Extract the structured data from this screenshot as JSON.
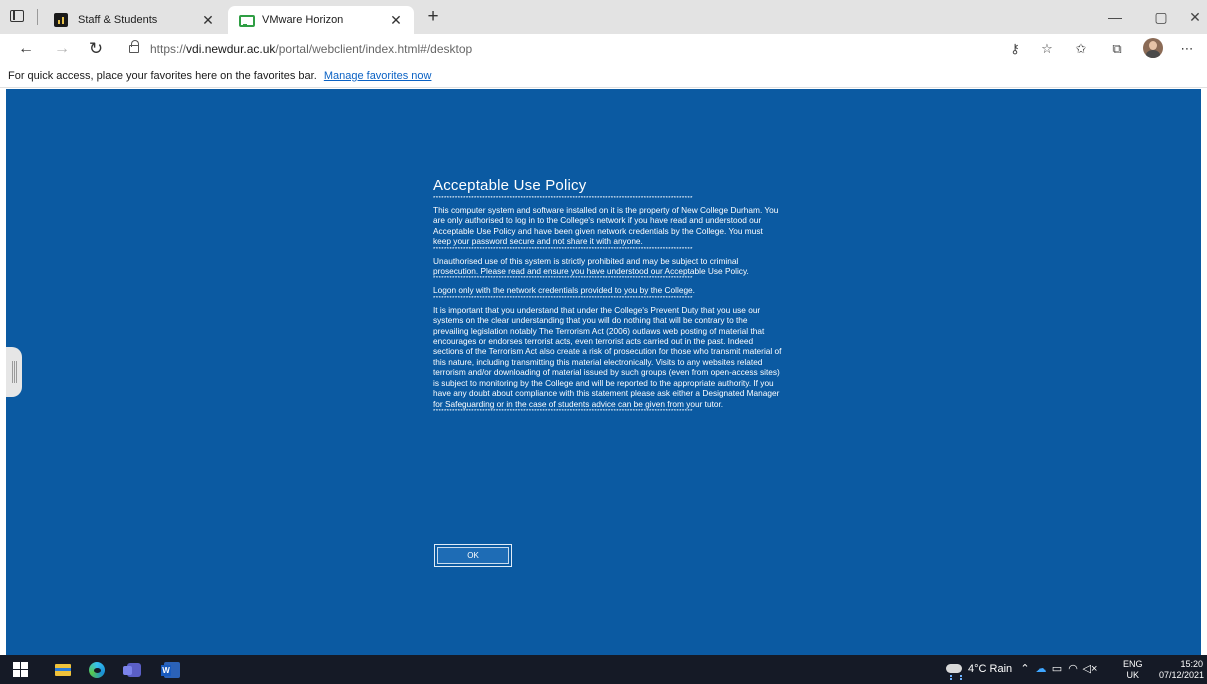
{
  "browser": {
    "tabs": [
      {
        "title": "Staff & Students",
        "favicon": "bars-logo-icon",
        "active": false
      },
      {
        "title": "VMware Horizon",
        "favicon": "vmware-horizon-icon",
        "active": true
      }
    ],
    "new_tab_symbol": "+",
    "window_controls": {
      "minimize": "—",
      "maximize": "▢",
      "close": "✕"
    },
    "address": {
      "scheme": "https://",
      "host": "vdi.newdur.ac.uk",
      "path": "/portal/webclient/index.html#/desktop"
    },
    "favorites_bar": {
      "text": "For quick access, place your favorites here on the favorites bar.",
      "link": "Manage favorites now"
    }
  },
  "dialog": {
    "title": "Acceptable Use Policy",
    "stars": "***********************************************************************************************",
    "paragraphs": [
      "This computer system and software installed on it is the property of New College Durham. You are only authorised to log in to the College's network if you have read and understood our Acceptable Use Policy and have been given network credentials by the College. You must keep your password secure and not share it with anyone.",
      "Unauthorised use of this system is strictly prohibited and may be subject to criminal prosecution. Please read and ensure you have understood our Acceptable Use Policy.",
      "Logon only with the network credentials provided to you by the College.",
      "It is important that you understand that under the College's Prevent Duty that you use our systems on the clear understanding that you will do nothing that will be contrary to the prevailing legislation notably The Terrorism Act (2006) outlaws web posting of material that encourages or endorses terrorist acts, even terrorist acts carried out in the past. Indeed sections of the Terrorism Act also create a risk of prosecution for those who transmit material of this nature, including transmitting this material electronically.  Visits to any websites related terrorism and/or downloading of material issued by such  groups (even from open-access sites) is subject to monitoring by the College and will be reported to the appropriate authority. If you have any doubt about compliance with this statement please ask either a Designated Manager for Safeguarding or in the case of students advice can be given from your tutor."
    ],
    "ok_label": "OK"
  },
  "taskbar": {
    "weather": "4°C  Rain",
    "language": {
      "line1": "ENG",
      "line2": "UK"
    },
    "clock": {
      "time": "15:20",
      "date": "07/12/2021"
    }
  }
}
